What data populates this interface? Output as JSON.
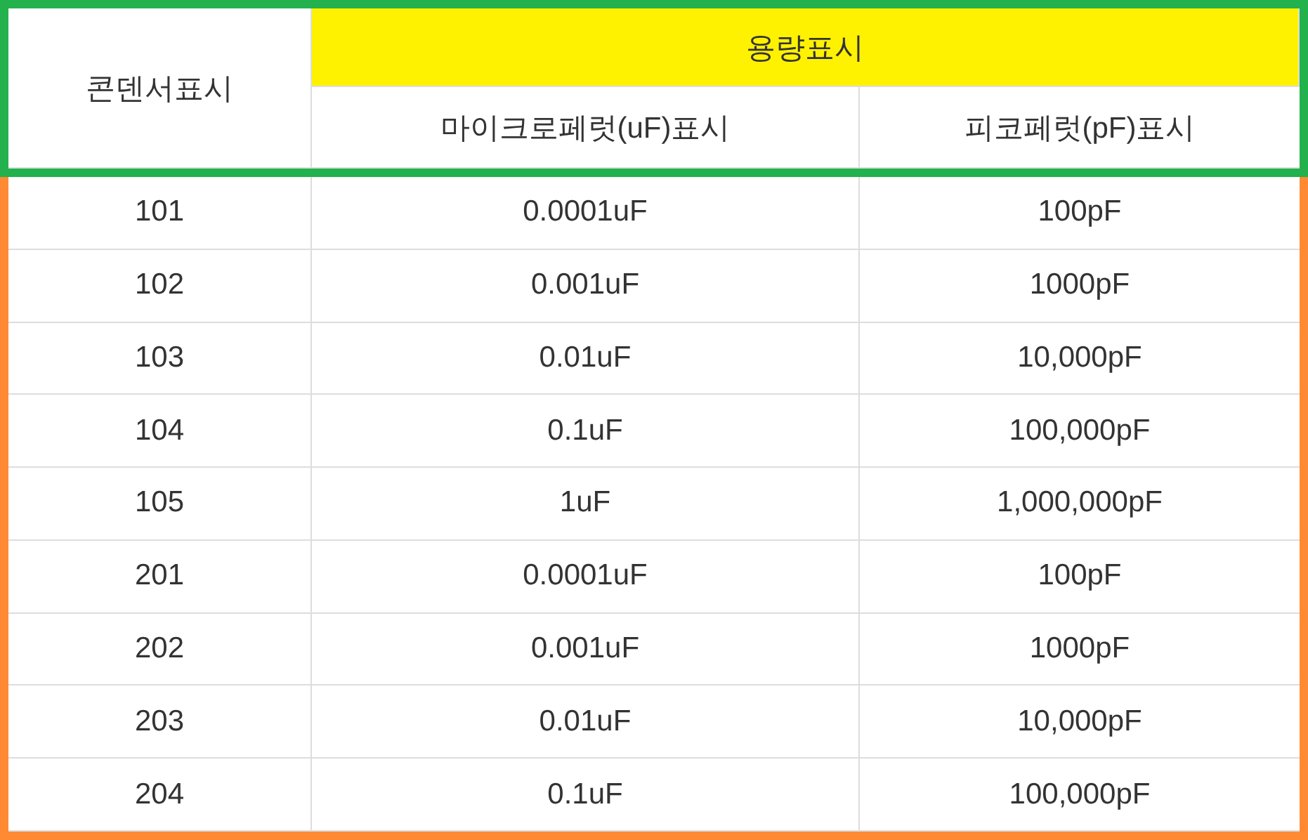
{
  "table": {
    "header": {
      "row_label": "콘덴서표시",
      "group": "용량표시",
      "columns": [
        "마이크로페럿(uF)표시",
        "피코페럿(pF)표시"
      ]
    },
    "rows": [
      {
        "code": "101",
        "microfarad": "0.0001uF",
        "picofarad": "100pF"
      },
      {
        "code": "102",
        "microfarad": "0.001uF",
        "picofarad": "1000pF"
      },
      {
        "code": "103",
        "microfarad": "0.01uF",
        "picofarad": "10,000pF"
      },
      {
        "code": "104",
        "microfarad": "0.1uF",
        "picofarad": "100,000pF"
      },
      {
        "code": "105",
        "microfarad": "1uF",
        "picofarad": "1,000,000pF"
      },
      {
        "code": "201",
        "microfarad": "0.0001uF",
        "picofarad": "100pF"
      },
      {
        "code": "202",
        "microfarad": "0.001uF",
        "picofarad": "1000pF"
      },
      {
        "code": "203",
        "microfarad": "0.01uF",
        "picofarad": "10,000pF"
      },
      {
        "code": "204",
        "microfarad": "0.1uF",
        "picofarad": "100,000pF"
      }
    ]
  }
}
